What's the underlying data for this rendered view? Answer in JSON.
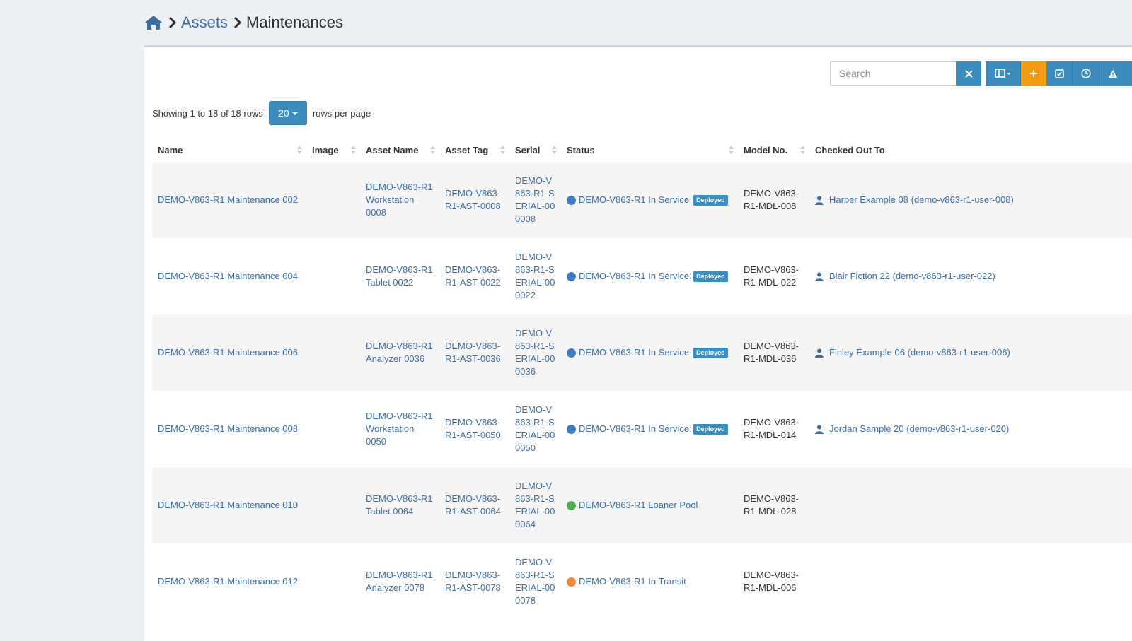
{
  "breadcrumb": {
    "home_icon": "home-icon",
    "items": [
      {
        "label": "Assets"
      },
      {
        "label": "Maintenances"
      }
    ]
  },
  "toolbar": {
    "search_placeholder": "Search",
    "clear_icon": "close-icon",
    "columns_icon": "columns-icon",
    "add_icon": "plus-icon",
    "checkin_icon": "checkbox-icon",
    "history_icon": "clock-icon",
    "alert_icon": "warning-icon"
  },
  "colors": {
    "primary": "#3c8dbc",
    "orange": "#f39c12",
    "link": "#3c6ea0",
    "status_in_service": "#3c7dc4",
    "status_loaner": "#4caf50",
    "status_transit": "#f0883a"
  },
  "pagination": {
    "showing_text": "Showing 1 to 18 of 18 rows",
    "page_size": "20",
    "rows_per_page_label": "rows per page"
  },
  "table": {
    "columns": [
      "Name",
      "Image",
      "Asset Name",
      "Asset Tag",
      "Serial",
      "Status",
      "Model No.",
      "Checked Out To"
    ],
    "rows": [
      {
        "name": "DEMO-V863-R1 Maintenance 002",
        "asset_name": "DEMO-V863-R1 Workstation 0008",
        "asset_tag": "DEMO-V863-R1-AST-0008",
        "serial": "DEMO-V863-R1-SERIAL-000008",
        "status": "DEMO-V863-R1 In Service",
        "status_color": "#3c7dc4",
        "badge": "Deployed",
        "model_no": "DEMO-V863-R1-MDL-008",
        "checked_out_to": "Harper Example 08 (demo-v863-r1-user-008)"
      },
      {
        "name": "DEMO-V863-R1 Maintenance 004",
        "asset_name": "DEMO-V863-R1 Tablet 0022",
        "asset_tag": "DEMO-V863-R1-AST-0022",
        "serial": "DEMO-V863-R1-SERIAL-000022",
        "status": "DEMO-V863-R1 In Service",
        "status_color": "#3c7dc4",
        "badge": "Deployed",
        "model_no": "DEMO-V863-R1-MDL-022",
        "checked_out_to": "Blair Fiction 22 (demo-v863-r1-user-022)"
      },
      {
        "name": "DEMO-V863-R1 Maintenance 006",
        "asset_name": "DEMO-V863-R1 Analyzer 0036",
        "asset_tag": "DEMO-V863-R1-AST-0036",
        "serial": "DEMO-V863-R1-SERIAL-000036",
        "status": "DEMO-V863-R1 In Service",
        "status_color": "#3c7dc4",
        "badge": "Deployed",
        "model_no": "DEMO-V863-R1-MDL-036",
        "checked_out_to": "Finley Example 06 (demo-v863-r1-user-006)"
      },
      {
        "name": "DEMO-V863-R1 Maintenance 008",
        "asset_name": "DEMO-V863-R1 Workstation 0050",
        "asset_tag": "DEMO-V863-R1-AST-0050",
        "serial": "DEMO-V863-R1-SERIAL-000050",
        "status": "DEMO-V863-R1 In Service",
        "status_color": "#3c7dc4",
        "badge": "Deployed",
        "model_no": "DEMO-V863-R1-MDL-014",
        "checked_out_to": "Jordan Sample 20 (demo-v863-r1-user-020)"
      },
      {
        "name": "DEMO-V863-R1 Maintenance 010",
        "asset_name": "DEMO-V863-R1 Tablet 0064",
        "asset_tag": "DEMO-V863-R1-AST-0064",
        "serial": "DEMO-V863-R1-SERIAL-000064",
        "status": "DEMO-V863-R1 Loaner Pool",
        "status_color": "#4caf50",
        "badge": "",
        "model_no": "DEMO-V863-R1-MDL-028",
        "checked_out_to": ""
      },
      {
        "name": "DEMO-V863-R1 Maintenance 012",
        "asset_name": "DEMO-V863-R1 Analyzer 0078",
        "asset_tag": "DEMO-V863-R1-AST-0078",
        "serial": "DEMO-V863-R1-SERIAL-000078",
        "status": "DEMO-V863-R1 In Transit",
        "status_color": "#f0883a",
        "badge": "",
        "model_no": "DEMO-V863-R1-MDL-006",
        "checked_out_to": ""
      }
    ]
  }
}
